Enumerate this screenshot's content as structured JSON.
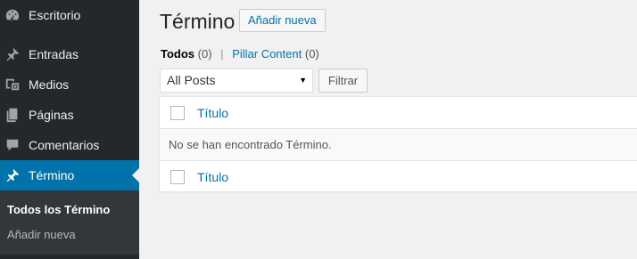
{
  "sidebar": {
    "items": [
      {
        "label": "Escritorio",
        "icon": "dashboard-icon"
      },
      {
        "label": "Entradas",
        "icon": "pin-icon"
      },
      {
        "label": "Medios",
        "icon": "media-icon"
      },
      {
        "label": "Páginas",
        "icon": "pages-icon"
      },
      {
        "label": "Comentarios",
        "icon": "comments-icon"
      },
      {
        "label": "Término",
        "icon": "pin-icon",
        "current": true
      }
    ],
    "submenu": [
      {
        "label": "Todos los Término",
        "current": true
      },
      {
        "label": "Añadir nueva"
      }
    ]
  },
  "main": {
    "title": "Término",
    "add_new_label": "Añadir nueva",
    "views": {
      "all_label": "Todos",
      "all_count": "(0)",
      "separator": "|",
      "pillar_label": "Pillar Content",
      "pillar_count": "(0)"
    },
    "filter": {
      "select_value": "All Posts",
      "button_label": "Filtrar"
    },
    "table": {
      "header_title": "Título",
      "empty_message": "No se han encontrado Término.",
      "footer_title": "Título"
    }
  },
  "colors": {
    "sidebar_bg": "#23282d",
    "accent": "#0073aa",
    "page_bg": "#f1f1f1"
  }
}
